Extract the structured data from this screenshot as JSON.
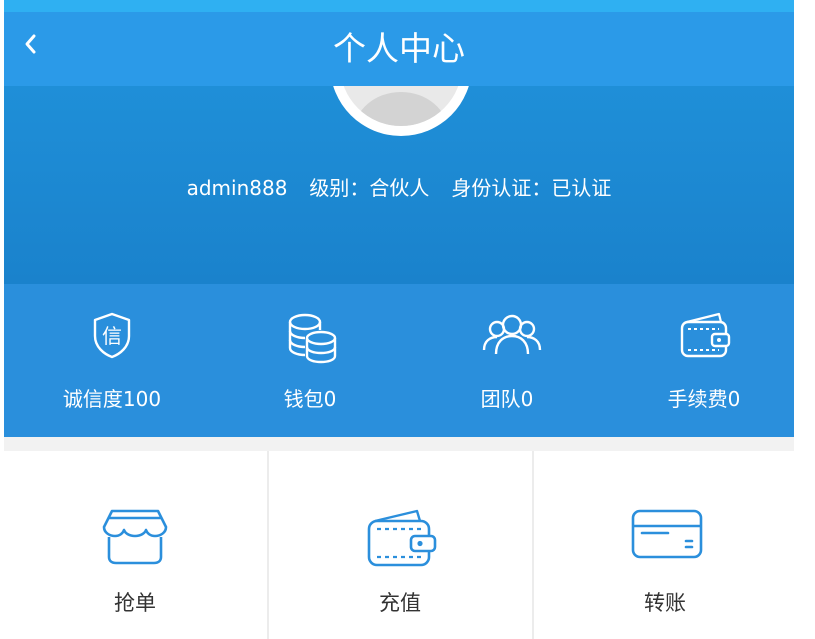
{
  "header": {
    "title": "个人中心",
    "back_icon": "chevron-left-icon"
  },
  "profile": {
    "username": "admin888",
    "level": "级别：合伙人",
    "verification": "身份认证：已认证"
  },
  "stats": [
    {
      "label": "诚信度100",
      "icon": "credit-shield-icon"
    },
    {
      "label": "钱包0",
      "icon": "coins-icon"
    },
    {
      "label": "团队0",
      "icon": "team-icon"
    },
    {
      "label": "手续费0",
      "icon": "wallet-icon"
    }
  ],
  "actions": [
    {
      "label": "抢单",
      "icon": "shop-awning-icon"
    },
    {
      "label": "充值",
      "icon": "wallet-icon"
    },
    {
      "label": "转账",
      "icon": "card-icon"
    }
  ],
  "colors": {
    "nav": "#2b9ae8",
    "hero": "#1a82cc",
    "stats": "#2a8fdc",
    "icon_accent": "#2b8fdc",
    "text_dark": "#333333"
  }
}
